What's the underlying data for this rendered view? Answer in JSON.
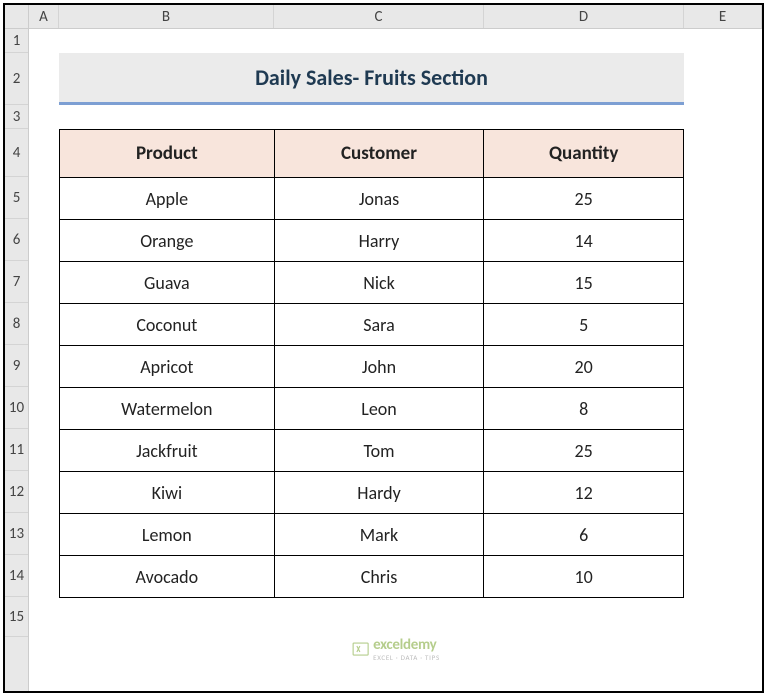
{
  "columns": [
    "A",
    "B",
    "C",
    "D",
    "E"
  ],
  "rows": [
    "1",
    "2",
    "3",
    "4",
    "5",
    "6",
    "7",
    "8",
    "9",
    "10",
    "11",
    "12",
    "13",
    "14",
    "15"
  ],
  "title": "Daily Sales- Fruits Section",
  "table": {
    "headers": {
      "product": "Product",
      "customer": "Customer",
      "quantity": "Quantity"
    },
    "rows": [
      {
        "product": "Apple",
        "customer": "Jonas",
        "quantity": "25"
      },
      {
        "product": "Orange",
        "customer": "Harry",
        "quantity": "14"
      },
      {
        "product": "Guava",
        "customer": "Nick",
        "quantity": "15"
      },
      {
        "product": "Coconut",
        "customer": "Sara",
        "quantity": "5"
      },
      {
        "product": "Apricot",
        "customer": "John",
        "quantity": "20"
      },
      {
        "product": "Watermelon",
        "customer": "Leon",
        "quantity": "8"
      },
      {
        "product": "Jackfruit",
        "customer": "Tom",
        "quantity": "25"
      },
      {
        "product": "Kiwi",
        "customer": "Hardy",
        "quantity": "12"
      },
      {
        "product": "Lemon",
        "customer": "Mark",
        "quantity": "6"
      },
      {
        "product": "Avocado",
        "customer": "Chris",
        "quantity": "10"
      }
    ]
  },
  "watermark": {
    "brand": "exceldemy",
    "tagline": "EXCEL · DATA · TIPS"
  }
}
